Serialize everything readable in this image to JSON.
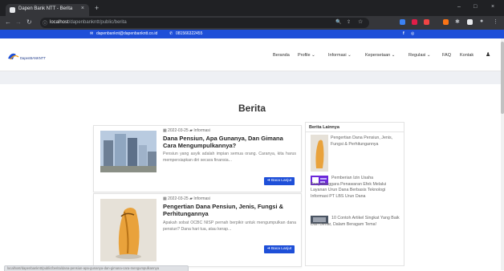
{
  "browser": {
    "tab_title": "Dapen Bank NTT - Berita",
    "tab_close": "×",
    "new_tab": "+",
    "url_host": "localhost",
    "url_path": "/dapenbankntt/public/berita",
    "window_min": "–",
    "window_max": "□",
    "window_close": "×"
  },
  "topbar": {
    "email": "dapenbanknt@dapenbankntt.co.id",
    "phone": "081566322455",
    "bg_color": "#1e4fd8"
  },
  "header": {
    "logo_text": "DapenBANKNTT",
    "menu": [
      {
        "label": "Beranda"
      },
      {
        "label": "Profile ⌄"
      },
      {
        "label": "Informasi ⌄"
      },
      {
        "label": "Kepersetaan ⌄"
      },
      {
        "label": "Regulasi ⌄"
      },
      {
        "label": "FAQ"
      },
      {
        "label": "Kontak"
      }
    ]
  },
  "page": {
    "title": "Berita"
  },
  "posts": [
    {
      "date": "2022-03-25",
      "category": "Informasi",
      "title": "Dana Pensiun, Apa Gunanya, Dan Gimana Cara Mengumpulkannya?",
      "excerpt": "Pensiun yang asyik adalah impian semua orang. Caranya, kita harus mempersiapkan diri secara finansia...",
      "button": "Baca Lanjut"
    },
    {
      "date": "2022-03-25",
      "category": "Informasi",
      "title": "Pengertian Dana Pensiun, Jenis, Fungsi & Perhitungannya",
      "excerpt": "Apakah sobat OCBC NISP pernah berpikir untuk mengumpulkan dana pensiun? Dana hari tua, atau kerap...",
      "button": "Baca Lanjut"
    }
  ],
  "sidebar": {
    "heading": "Berita Lainnya",
    "items": [
      {
        "title": "Pengertian Dana Pensiun, Jenis, Fungsi & Perhitungannya"
      },
      {
        "title": "Pemberian Izin Usaha Penyelenggara Penawaran Efek Melalui Layanan Urun Dana Berbasis Teknologi Informasi PT LBS Urun Dana"
      },
      {
        "title": "10 Contoh Artikel Singkat Yang Baik Dan Benar, Dalam Beragam Tema!"
      }
    ]
  },
  "status": {
    "text": "localhost/dapenbankntt/public/berita/dana-pensiun-apa-gunanya-dan-gimana-cara-mengumpulkannya"
  }
}
